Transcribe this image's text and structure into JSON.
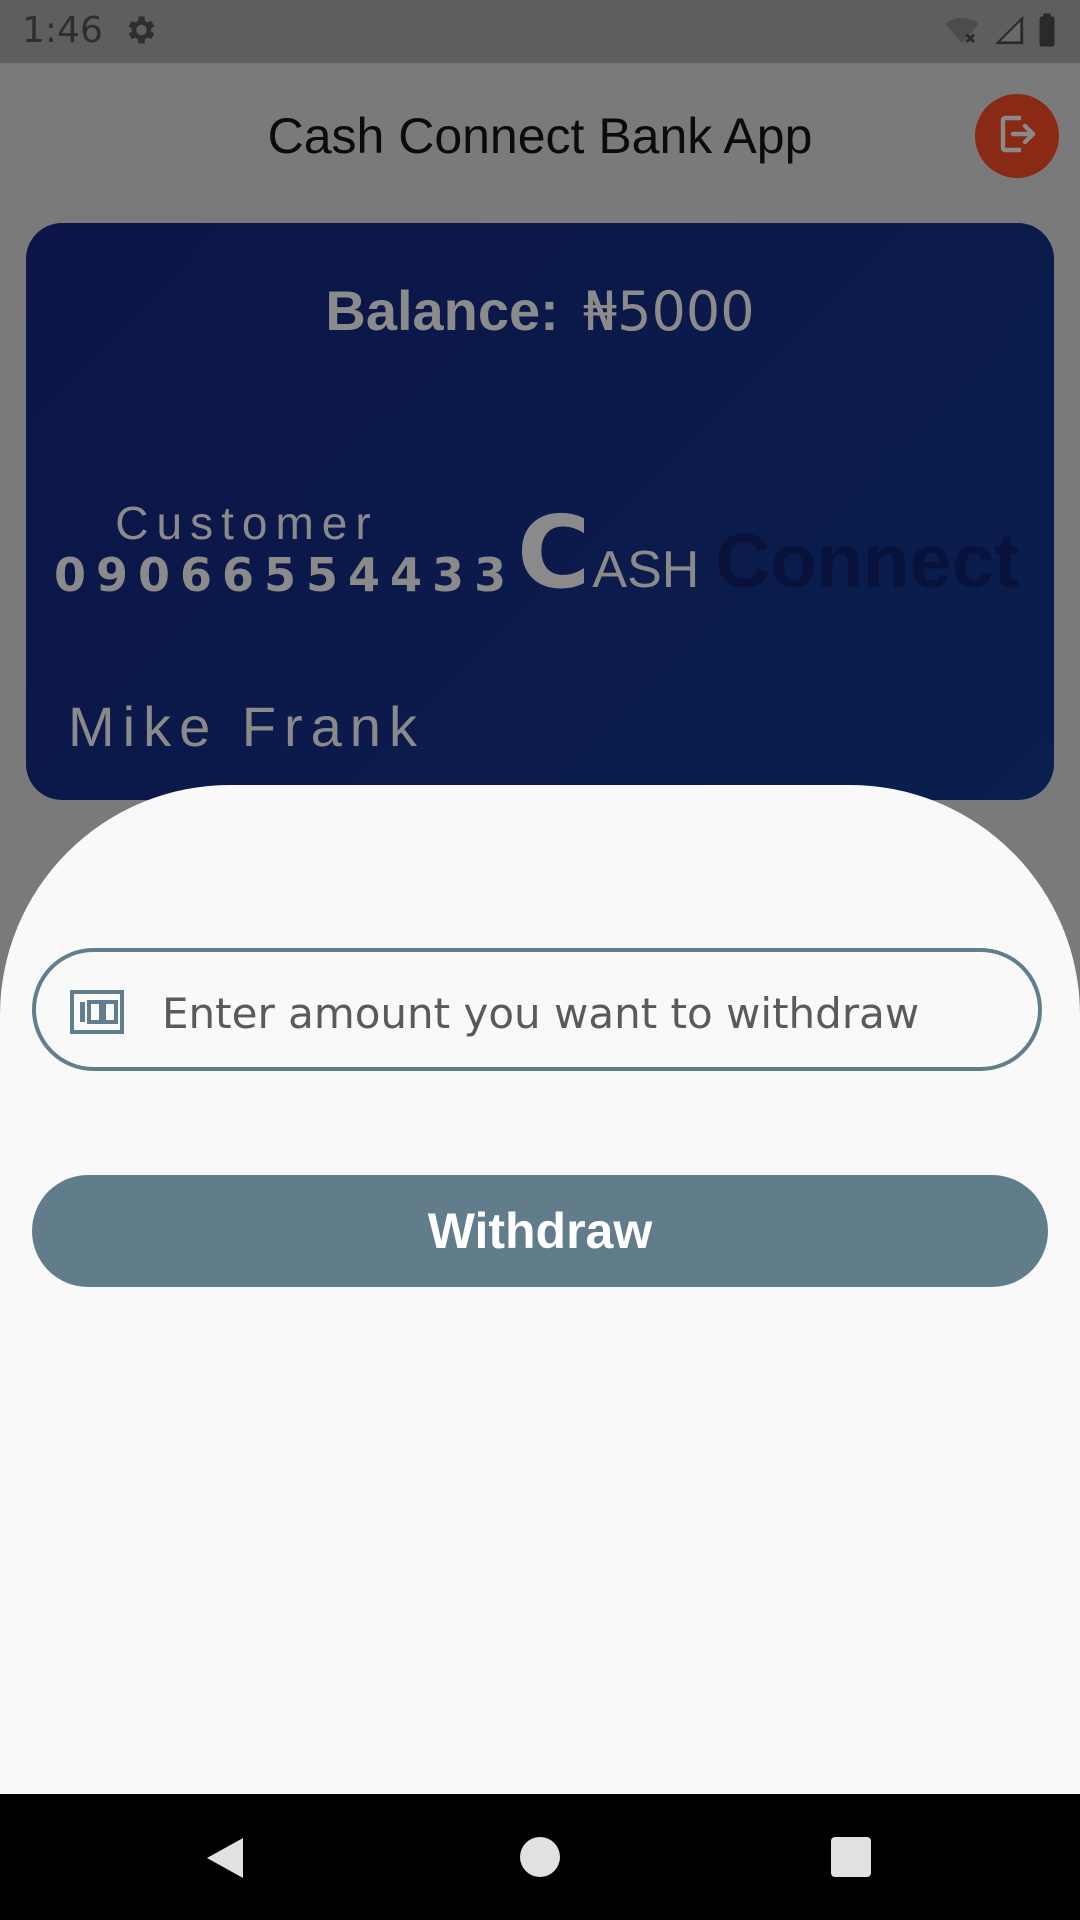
{
  "status_bar": {
    "time": "1:46",
    "icons": [
      "gear-icon",
      "wifi-off-icon",
      "signal-icon",
      "battery-icon"
    ]
  },
  "app_bar": {
    "title": "Cash Connect Bank App",
    "logout_icon": "logout-icon"
  },
  "card": {
    "balance_label": "Balance:",
    "balance_value": "₦5000",
    "customer_label": "Customer",
    "customer_number": "09066554433",
    "brand_c": "C",
    "brand_ash": "ASH",
    "brand_connect": "Connect",
    "holder_name": "Mike Frank"
  },
  "withdraw_sheet": {
    "amount_placeholder": "Enter amount you want to withdraw",
    "amount_value": "",
    "withdraw_label": "Withdraw"
  },
  "nav_bar": {
    "icons": [
      "back-icon",
      "home-icon",
      "recents-icon"
    ]
  },
  "colors": {
    "accent": "#617d8c",
    "logout": "#8b2a14",
    "card": "#0b1a4a"
  }
}
